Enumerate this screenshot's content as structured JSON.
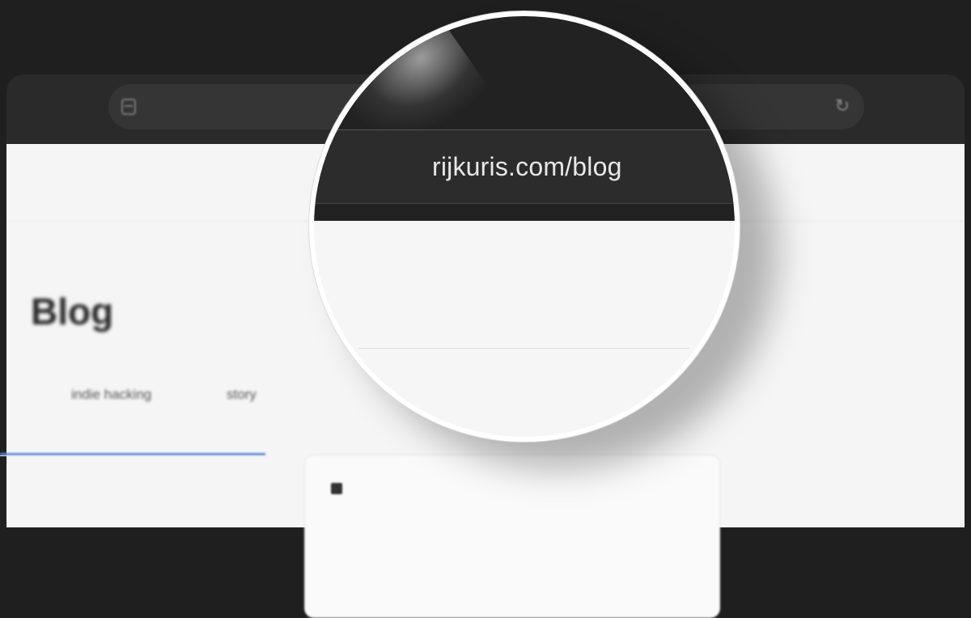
{
  "browser": {
    "address_bar": {
      "url": "rijkuris.com/blog",
      "site_icon": "site-info-icon",
      "reload_icon": "reload-icon"
    }
  },
  "page": {
    "title": "Blog",
    "tags": [
      {
        "label": "indie hacking"
      },
      {
        "label": "story"
      }
    ],
    "active_tag_color": "#5b8ee0"
  },
  "magnifier": {
    "url": "rijkuris.com/blog"
  }
}
